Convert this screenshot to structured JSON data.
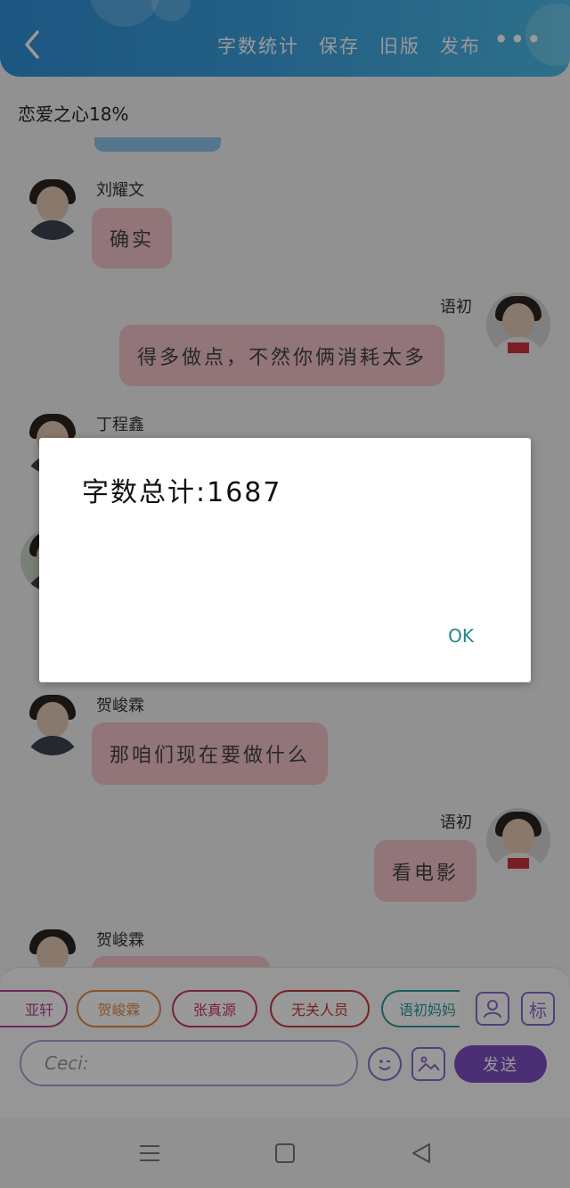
{
  "header": {
    "actions": [
      "字数统计",
      "保存",
      "旧版",
      "发布"
    ],
    "more_label": "•••"
  },
  "love_status": "恋爱之心18%",
  "messages": [
    {
      "side": "left",
      "name": "刘耀文",
      "text": "确实"
    },
    {
      "side": "right",
      "name": "语初",
      "text": "得多做点，不然你俩消耗太多"
    },
    {
      "side": "left",
      "name": "丁程鑫",
      "text": ""
    },
    {
      "side": "left",
      "name": "",
      "text": ""
    },
    {
      "side": "left",
      "name": "贺峻霖",
      "text": "那咱们现在要做什么"
    },
    {
      "side": "right",
      "name": "语初",
      "text": "看电影"
    },
    {
      "side": "left",
      "name": "贺峻霖",
      "text": ""
    }
  ],
  "characters": [
    "亚轩",
    "贺峻霖",
    "张真源",
    "无关人员",
    "语初妈妈"
  ],
  "character_colors": [
    "#b04a8a",
    "#e08a4a",
    "#c83a5a",
    "#c83a3a",
    "#2a9a9a"
  ],
  "toolbar": {
    "tag_label": "标",
    "input_placeholder": "Ceci:",
    "send_label": "发送"
  },
  "dialog": {
    "message": "字数总计:1687",
    "ok_label": "OK"
  },
  "colors": {
    "header": "#3a9ad9",
    "bubble": "#f2c4c8",
    "accent": "#7e4fc2",
    "ok": "#1f8a8a"
  }
}
